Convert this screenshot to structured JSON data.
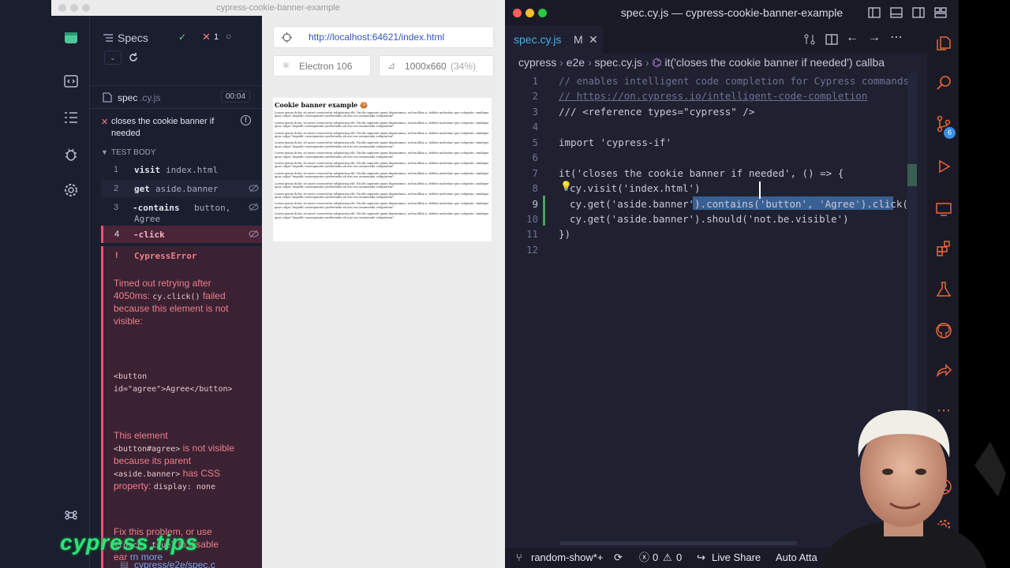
{
  "cypress": {
    "window_title": "cypress-cookie-banner-example",
    "header": {
      "specs_label": "Specs",
      "passed_count": "",
      "failed_count": "1",
      "spec_name": "spec",
      "spec_ext": ".cy.js",
      "duration": "00:04"
    },
    "test": {
      "title": "closes the cookie banner if needed",
      "body_label": "TEST BODY"
    },
    "steps": [
      {
        "num": "1",
        "cmd": "visit",
        "arg": "index.html"
      },
      {
        "num": "2",
        "cmd": "get",
        "arg": "aside.banner"
      },
      {
        "num": "3",
        "cmd": "-contains",
        "arg": "button,",
        "arg2": "Agree"
      },
      {
        "num": "4",
        "cmd": "-click",
        "arg": ""
      }
    ],
    "error": {
      "bang": "!",
      "name": "CypressError",
      "msg1a": "Timed out retrying after",
      "msg1b": "4050ms:",
      "msg1code": "cy.click()",
      "msg1c": "failed",
      "msg1d": "because this element is not",
      "msg1e": "visible:",
      "html1": "<button",
      "html2": "id=\"agree\">Agree</button>",
      "msg2a": "This element",
      "msg2code1": "<button#agree>",
      "msg2b": "is not visible",
      "msg2c": "because its parent",
      "msg2code2": "<aside.banner>",
      "msg2d": "has CSS",
      "msg2e": "property:",
      "msg2code3": "display: none",
      "msg3a": "Fix this problem, or use",
      "msg3code": "{force: true}",
      "msg3b": "to disable",
      "msg3c": "ear",
      "msg3link": "rn more",
      "file": "cypress/e2e/spec.c"
    },
    "aut": {
      "url": "http://localhost:64621/index.html",
      "browser": "Electron 106",
      "viewport": "1000x660",
      "scale": "(34%)",
      "page_title": "Cookie banner example 🍪",
      "lorem": "Lorem ipsum dolor, sit amet consectetur adipisicing elit. Facilis sapiente quam dignissimos, sed mollitia a, debitis molestiae quo voluptate, similique quas culpa? Impedit consequuntur perferendis ab nisi eos assumenda voluptatem?"
    }
  },
  "vscode": {
    "window_title": "spec.cy.js — cypress-cookie-banner-example",
    "tab_label": "spec.cy.js",
    "tab_modified": "M",
    "breadcrumb": [
      "cypress",
      "e2e",
      "spec.cy.js",
      "it('closes the cookie banner if needed') callba"
    ],
    "code": [
      {
        "n": "1",
        "t": "// enables intelligent code completion for Cypress commands"
      },
      {
        "n": "2",
        "t": "// https://on.cypress.io/intelligent-code-completion"
      },
      {
        "n": "3",
        "t": "/// <reference types=\"cypress\" />"
      },
      {
        "n": "4",
        "t": ""
      },
      {
        "n": "5",
        "t": "import 'cypress-if'"
      },
      {
        "n": "6",
        "t": ""
      },
      {
        "n": "7",
        "t": "it('closes the cookie banner if needed', () => {"
      },
      {
        "n": "8",
        "t": "cy.visit('index.html')"
      },
      {
        "n": "9",
        "t": "cy.get('aside.banner').contains('button', 'Agree').click()"
      },
      {
        "n": "10",
        "t": "cy.get('aside.banner').should('not.be.visible')"
      },
      {
        "n": "11",
        "t": "})"
      },
      {
        "n": "12",
        "t": ""
      }
    ],
    "scm_badge": "6",
    "status": {
      "branch": "random-show*+",
      "errors": "0",
      "warnings": "0",
      "live_share": "Live Share",
      "auto_attach": "Auto Atta"
    }
  },
  "brand": "cypress.tips",
  "colors": {
    "accent_green": "#31e079",
    "error_red": "#f07d8a",
    "vscode_orange": "#e8663a"
  }
}
